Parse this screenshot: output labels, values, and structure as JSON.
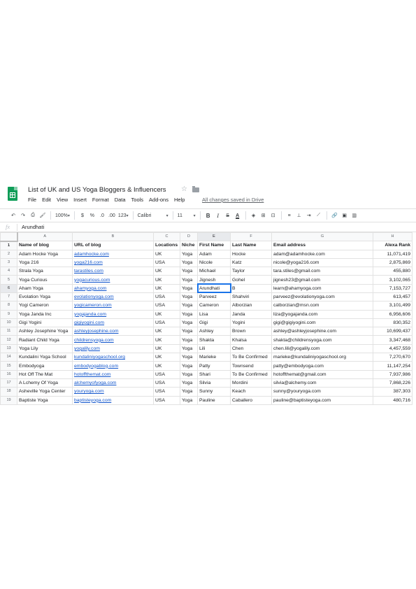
{
  "title": "List of UK and US Yoga Bloggers & Influencers",
  "menu": [
    "File",
    "Edit",
    "View",
    "Insert",
    "Format",
    "Data",
    "Tools",
    "Add-ons",
    "Help"
  ],
  "save_status": "All changes saved in Drive",
  "toolbar": {
    "zoom": "100%",
    "currency": "$",
    "percent": "%",
    "decrease_decimal": ".0",
    "increase_decimal": ".00",
    "more_formats": "123",
    "font": "Calibri",
    "font_size": "11",
    "bold": "B",
    "italic": "I",
    "strike": "S",
    "text_color": "A"
  },
  "formula_bar": {
    "fx": "fx",
    "value": "Arundhati"
  },
  "column_letters": [
    "A",
    "B",
    "C",
    "D",
    "E",
    "F",
    "G",
    "H"
  ],
  "active_cell": {
    "row": 6,
    "col": "E"
  },
  "headers": [
    "Name of blog",
    "URL of blog",
    "Locations",
    "Niche",
    "First Name",
    "Last Name",
    "Email address",
    "Alexa Rank"
  ],
  "rows": [
    {
      "n": "2",
      "name": "Adam Hocke Yoga",
      "url": "adamhocke.com",
      "loc": "UK",
      "niche": "Yoga",
      "first": "Adam",
      "last": "Hocke",
      "email": "adam@adamhocke.com",
      "rank": "11,071,419"
    },
    {
      "n": "3",
      "name": "Yoga 216",
      "url": "yoga216.com",
      "loc": "USA",
      "niche": "Yoga",
      "first": "Nicole",
      "last": "Katz",
      "email": "nicole@yoga216.com",
      "rank": "2,875,869"
    },
    {
      "n": "4",
      "name": "Strala Yoga",
      "url": "tarastiles.com",
      "loc": "UK",
      "niche": "Yoga",
      "first": "Michael",
      "last": "Taylor",
      "email": "tara.stiles@gmail.com",
      "rank": "455,880"
    },
    {
      "n": "5",
      "name": "Yoga Curious",
      "url": "yogacurious.com",
      "loc": "UK",
      "niche": "Yoga",
      "first": "Jignesh",
      "last": "Gohel",
      "email": "jignesh23@gmail.com",
      "rank": "3,102,065"
    },
    {
      "n": "6",
      "name": "Aham Yoga",
      "url": "ahamyoga.com",
      "loc": "UK",
      "niche": "Yoga",
      "first": "Arundhati",
      "last": "B",
      "email": "learn@ahamyoga.com",
      "rank": "7,153,727"
    },
    {
      "n": "7",
      "name": "Evolation Yoga",
      "url": "evolationyoga.com",
      "loc": "USA",
      "niche": "Yoga",
      "first": "Parveez",
      "last": "Shahviri",
      "email": "parveez@evolationyoga.com",
      "rank": "613,457"
    },
    {
      "n": "8",
      "name": "Yogi Cameron",
      "url": "yogicameron.com",
      "loc": "USA",
      "niche": "Yoga",
      "first": "Cameron",
      "last": "Alborzian",
      "email": "calborzian@msn.com",
      "rank": "3,101,499"
    },
    {
      "n": "9",
      "name": "Yoga Janda Inc",
      "url": "yogajanda.com",
      "loc": "UK",
      "niche": "Yoga",
      "first": "Lisa",
      "last": "Janda",
      "email": "liza@yogajanda.com",
      "rank": "6,956,606"
    },
    {
      "n": "10",
      "name": "Gigi Yogini",
      "url": "gigiyogini.com",
      "loc": "USA",
      "niche": "Yoga",
      "first": "Gigi",
      "last": "Yogini",
      "email": "gigi@gigiyogini.com",
      "rank": "830,352"
    },
    {
      "n": "11",
      "name": "Ashley Josephine Yoga",
      "url": "ashleyjosephine.com",
      "loc": "UK",
      "niche": "Yoga",
      "first": "Ashley",
      "last": "Brown",
      "email": "ashley@ashleyjosephine.com",
      "rank": "10,699,437"
    },
    {
      "n": "12",
      "name": "Radiant Child Yoga",
      "url": "childrensyoga.com",
      "loc": "UK",
      "niche": "Yoga",
      "first": "Shakta",
      "last": "Khalsa",
      "email": "shakta@childrensyoga.com",
      "rank": "3,347,468"
    },
    {
      "n": "13",
      "name": "Yoga Lily",
      "url": "yogalily.com",
      "loc": "UK",
      "niche": "Yoga",
      "first": "Lili",
      "last": "Chen",
      "email": "chen.lili@yogalily.com",
      "rank": "4,457,559"
    },
    {
      "n": "14",
      "name": "Kundalini Yoga School",
      "url": "kundaliniyogaschool.org",
      "loc": "UK",
      "niche": "Yoga",
      "first": "Marieke",
      "last": "To Be Confirmed",
      "email": "marieke@kundaliniyogaschool.org",
      "rank": "7,270,670"
    },
    {
      "n": "15",
      "name": "Embodyoga",
      "url": "embodyogablog.com",
      "loc": "UK",
      "niche": "Yoga",
      "first": "Patty",
      "last": "Townsend",
      "email": "patty@embodyoga.com",
      "rank": "11,147,254"
    },
    {
      "n": "16",
      "name": "Hot Off The Mat",
      "url": "hotoffthemat.com",
      "loc": "USA",
      "niche": "Yoga",
      "first": "Shari",
      "last": "To Be Confirmed",
      "email": "hotoffthemat@gmail.com",
      "rank": "7,937,986"
    },
    {
      "n": "17",
      "name": "A Lchemy Of Yoga",
      "url": "alchemyofyoga.com",
      "loc": "USA",
      "niche": "Yoga",
      "first": "Silvia",
      "last": "Mordini",
      "email": "silvia@alchemy.com",
      "rank": "7,868,226"
    },
    {
      "n": "18",
      "name": "Asheville Yoga Center",
      "url": "youryoga.com",
      "loc": "USA",
      "niche": "Yoga",
      "first": "Sunny",
      "last": "Keach",
      "email": "sunny@youryoga.com",
      "rank": "387,303"
    },
    {
      "n": "19",
      "name": "Baptiste Yoga",
      "url": "baptisteyoga.com",
      "loc": "USA",
      "niche": "Yoga",
      "first": "Pauline",
      "last": "Caballero",
      "email": "pauline@baptisteyoga.com",
      "rank": "480,716"
    }
  ]
}
